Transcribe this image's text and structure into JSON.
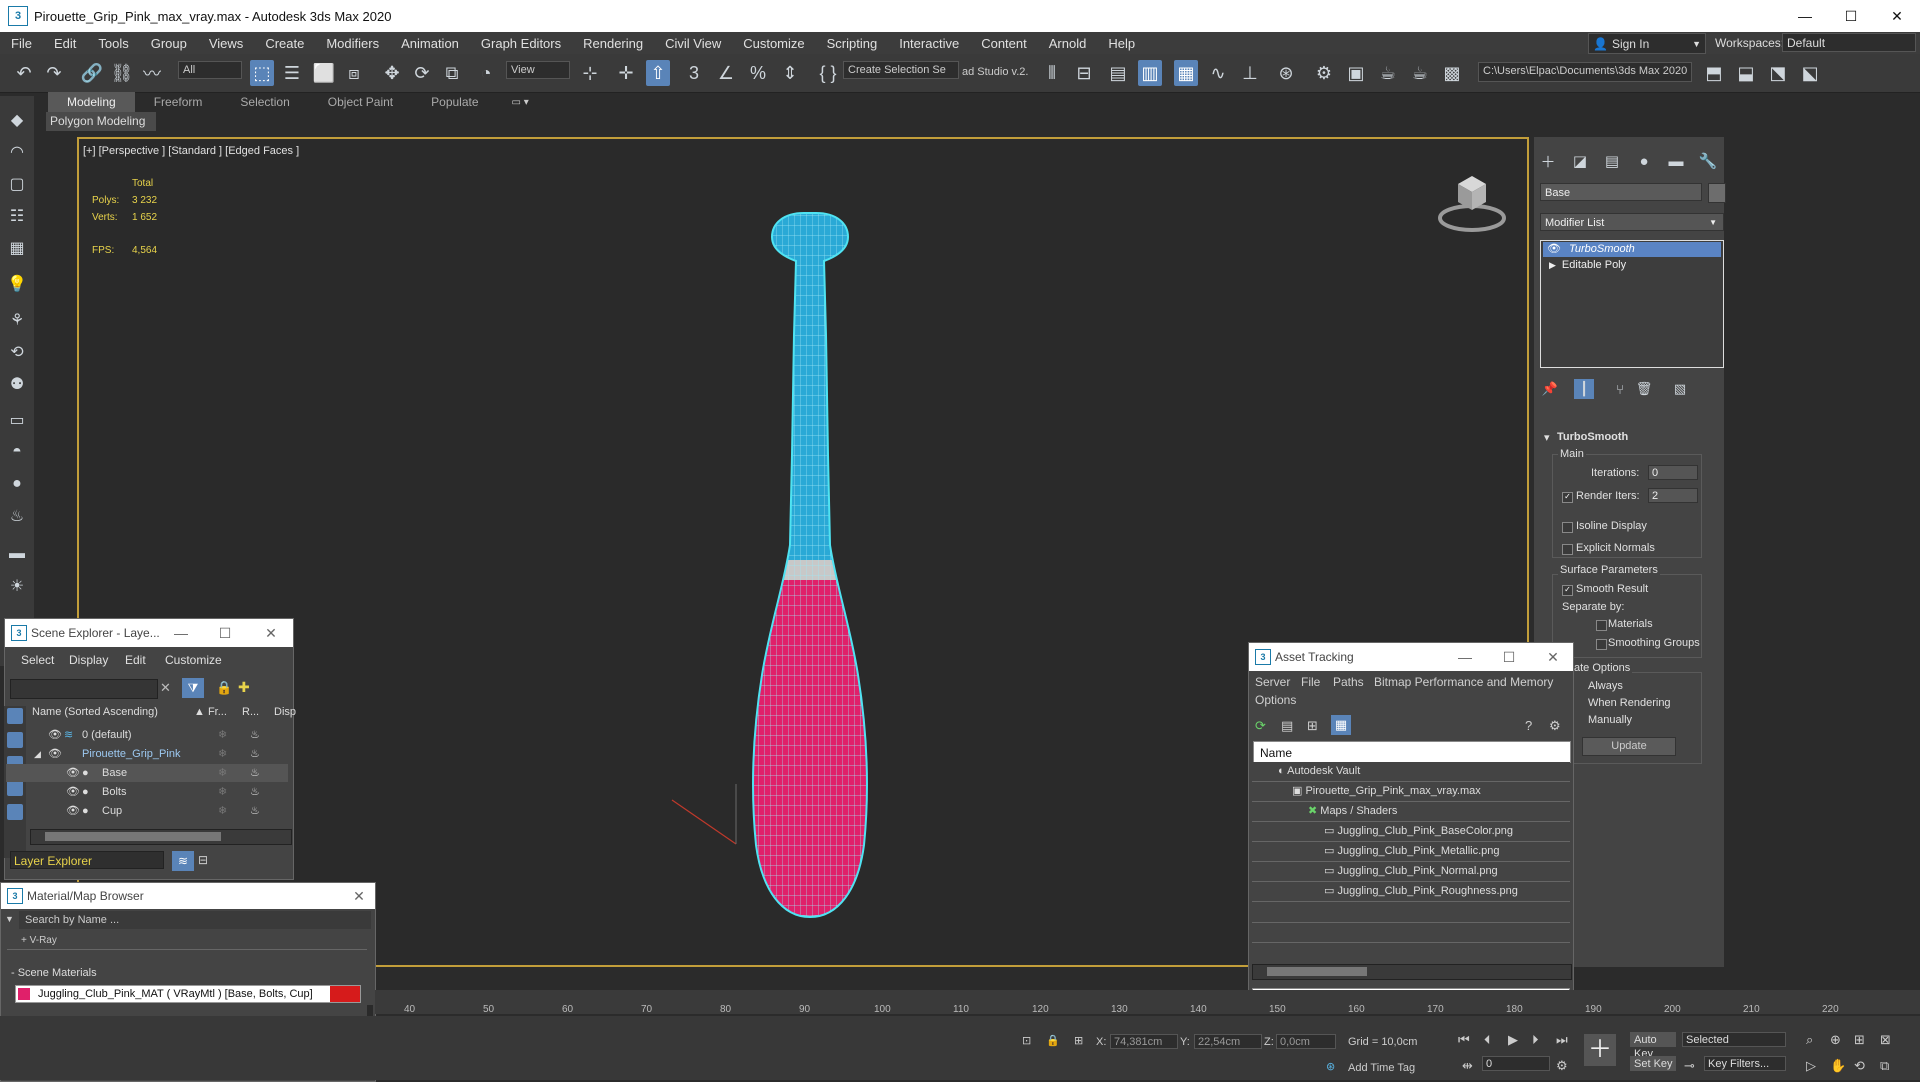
{
  "window": {
    "title": "Pirouette_Grip_Pink_max_vray.max - Autodesk 3ds Max 2020",
    "minimize": "—",
    "maximize": "☐",
    "close": "✕"
  },
  "menu": [
    "File",
    "Edit",
    "Tools",
    "Group",
    "Views",
    "Create",
    "Modifiers",
    "Animation",
    "Graph Editors",
    "Rendering",
    "Civil View",
    "Customize",
    "Scripting",
    "Interactive",
    "Content",
    "Arnold",
    "Help"
  ],
  "signin": {
    "label": "Sign In"
  },
  "workspaces": {
    "label": "Workspaces:",
    "value": "Default"
  },
  "toolbar": {
    "filter": "All",
    "refcoord": "View",
    "selection_set": "Create Selection Se",
    "studio": "ad Studio v.2.",
    "path": "C:\\Users\\Elpac\\Documents\\3ds Max 2020"
  },
  "ribbon": {
    "tabs": [
      "Modeling",
      "Freeform",
      "Selection",
      "Object Paint",
      "Populate"
    ],
    "active_tab": "Modeling",
    "panel": "Polygon Modeling"
  },
  "viewport": {
    "label": "[+] [Perspective ] [Standard ] [Edged Faces ]",
    "stats": {
      "header": "Total",
      "polys_label": "Polys:",
      "polys_value": "3 232",
      "verts_label": "Verts:",
      "verts_value": "1 652",
      "fps_label": "FPS:",
      "fps_value": "4,564"
    },
    "colors": {
      "top": "#2aa9d6",
      "bottom": "#e0206a",
      "wire": "#9ee7f5"
    }
  },
  "command_panel": {
    "object_name": "Base",
    "modifier_list": "Modifier List",
    "stack": [
      "TurboSmooth",
      "Editable Poly"
    ],
    "turbosmooth": {
      "title": "TurboSmooth",
      "main": "Main",
      "iterations_label": "Iterations:",
      "iterations_value": "0",
      "render_iters_label": "Render Iters:",
      "render_iters_value": "2",
      "isoline": "Isoline Display",
      "explicit": "Explicit Normals",
      "surface": "Surface Parameters",
      "smooth_result": "Smooth Result",
      "separate_by": "Separate by:",
      "materials": "Materials",
      "smoothing_groups": "Smoothing Groups",
      "update_options": "ate Options",
      "always": "Always",
      "when_rendering": "When Rendering",
      "manually": "Manually",
      "update_button": "Update"
    }
  },
  "scene_explorer": {
    "title": "Scene Explorer - Laye...",
    "menu": [
      "Select",
      "Display",
      "Edit",
      "Customize"
    ],
    "columns": [
      "Name (Sorted Ascending)",
      "▲ Fr...",
      "R...",
      "Disp"
    ],
    "rows": [
      "0 (default)",
      "Pirouette_Grip_Pink",
      "Base",
      "Bolts",
      "Cup"
    ],
    "footer": "Layer Explorer"
  },
  "material_browser": {
    "title": "Material/Map Browser",
    "search": "Search by Name ...",
    "vray": "+ V-Ray",
    "scene_materials": "- Scene Materials",
    "material": "Juggling_Club_Pink_MAT  ( VRayMtl ) [Base, Bolts, Cup]"
  },
  "asset_tracking": {
    "title": "Asset Tracking",
    "menu": [
      "Server",
      "File",
      "Paths",
      "Bitmap Performance and Memory"
    ],
    "menu2": "Options",
    "column": "Name",
    "rows": [
      "Autodesk Vault",
      "Pirouette_Grip_Pink_max_vray.max",
      "Maps / Shaders",
      "Juggling_Club_Pink_BaseColor.png",
      "Juggling_Club_Pink_Metallic.png",
      "Juggling_Club_Pink_Normal.png",
      "Juggling_Club_Pink_Roughness.png"
    ]
  },
  "timeline": {
    "ticks": [
      "40",
      "50",
      "60",
      "70",
      "80",
      "90",
      "100",
      "110",
      "120",
      "130",
      "140",
      "150",
      "160",
      "170",
      "180",
      "190",
      "200",
      "210",
      "220"
    ]
  },
  "status": {
    "x_label": "X:",
    "x_value": "74,381cm",
    "y_label": "Y:",
    "y_value": "22,54cm",
    "z_label": "Z:",
    "z_value": "0,0cm",
    "grid": "Grid = 10,0cm",
    "add_time_tag": "Add Time Tag",
    "auto_key": "Auto Key",
    "selected": "Selected",
    "set_key": "Set Key",
    "key_filters": "Key Filters...",
    "frame": "0"
  }
}
